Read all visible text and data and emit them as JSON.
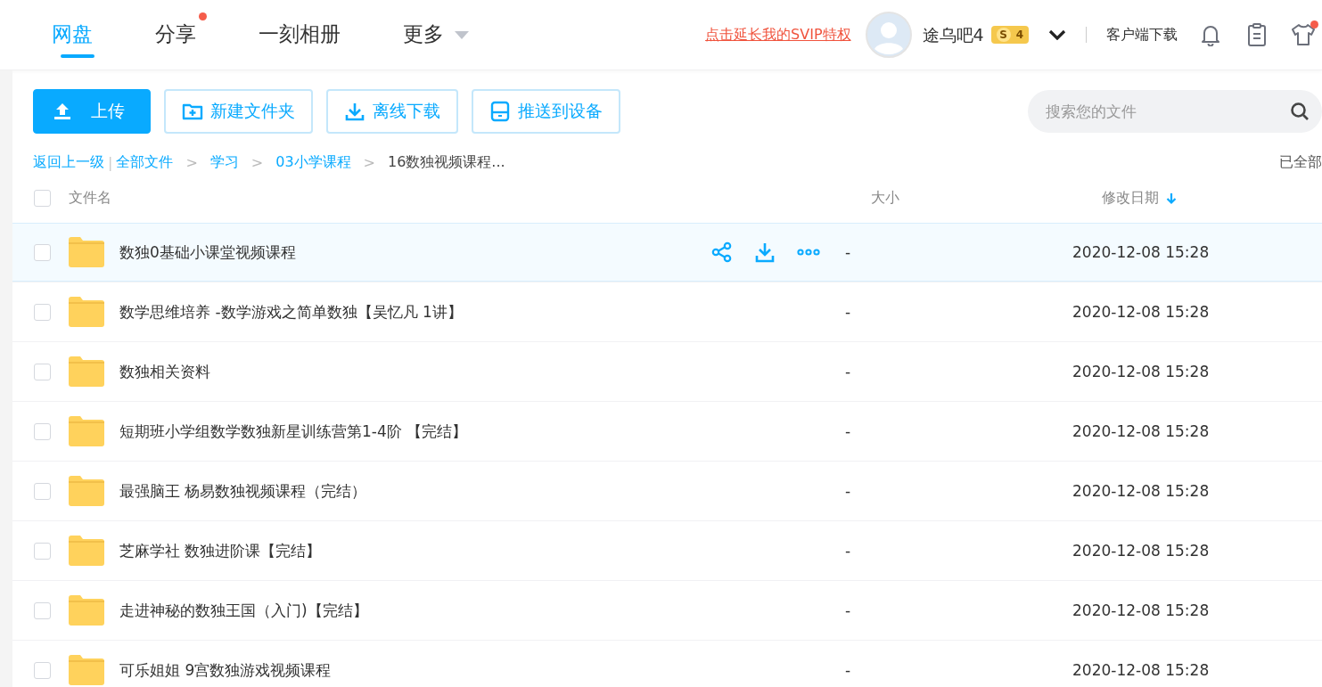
{
  "nav": {
    "tabs": [
      {
        "label": "网盘",
        "selected": true,
        "dot": false,
        "dropdown": false
      },
      {
        "label": "分享",
        "selected": false,
        "dot": true,
        "dropdown": false
      },
      {
        "label": "一刻相册",
        "selected": false,
        "dot": false,
        "dropdown": false
      },
      {
        "label": "更多",
        "selected": false,
        "dot": false,
        "dropdown": true
      }
    ],
    "promo_link": "点击延长我的SVIP特权",
    "user": {
      "name": "途乌吧4",
      "vip_letter": "S",
      "vip_level": "4"
    },
    "client_download": "客户端下载",
    "skin_dot": true
  },
  "toolbar": {
    "buttons": [
      {
        "label": "上传",
        "kind": "primary"
      },
      {
        "label": "新建文件夹",
        "kind": "outline"
      },
      {
        "label": "离线下载",
        "kind": "outline"
      },
      {
        "label": "推送到设备",
        "kind": "outline"
      }
    ],
    "search": {
      "placeholder": "搜索您的文件"
    }
  },
  "breadcrumb": {
    "items": [
      {
        "text": "返回上一级",
        "kind": "link"
      },
      {
        "text": "|",
        "kind": "divider"
      },
      {
        "text": "全部文件",
        "kind": "link"
      },
      {
        "text": ">",
        "kind": "separator"
      },
      {
        "text": "学习",
        "kind": "link"
      },
      {
        "text": ">",
        "kind": "separator"
      },
      {
        "text": "03小学课程",
        "kind": "link"
      },
      {
        "text": ">",
        "kind": "separator"
      },
      {
        "text": "16数独视频课程...",
        "kind": "current"
      }
    ],
    "status": "已全部"
  },
  "table": {
    "select_all_checked": false,
    "columns": [
      {
        "label": "文件名",
        "sorted": false
      },
      {
        "label": "大小",
        "sorted": false
      },
      {
        "label": "修改日期",
        "sorted": true
      }
    ],
    "rows": [
      {
        "name": "数独0基础小课堂视频课程",
        "size": "-",
        "date": "2020-12-08 15:28",
        "hovered": true,
        "checked": false
      },
      {
        "name": "数学思维培养 -数学游戏之简单数独【吴忆凡 1讲】",
        "size": "-",
        "date": "2020-12-08 15:28",
        "hovered": false,
        "checked": false
      },
      {
        "name": "数独相关资料",
        "size": "-",
        "date": "2020-12-08 15:28",
        "hovered": false,
        "checked": false
      },
      {
        "name": "短期班小学组数学数独新星训练营第1-4阶 【完结】",
        "size": "-",
        "date": "2020-12-08 15:28",
        "hovered": false,
        "checked": false
      },
      {
        "name": "最强脑王 杨易数独视频课程（完结）",
        "size": "-",
        "date": "2020-12-08 15:28",
        "hovered": false,
        "checked": false
      },
      {
        "name": "芝麻学社 数独进阶课【完结】",
        "size": "-",
        "date": "2020-12-08 15:28",
        "hovered": false,
        "checked": false
      },
      {
        "name": "走进神秘的数独王国（入门)【完结】",
        "size": "-",
        "date": "2020-12-08 15:28",
        "hovered": false,
        "checked": false
      },
      {
        "name": "可乐姐姐 9宫数独游戏视频课程",
        "size": "-",
        "date": "2020-12-08 15:28",
        "hovered": false,
        "checked": false
      }
    ]
  }
}
